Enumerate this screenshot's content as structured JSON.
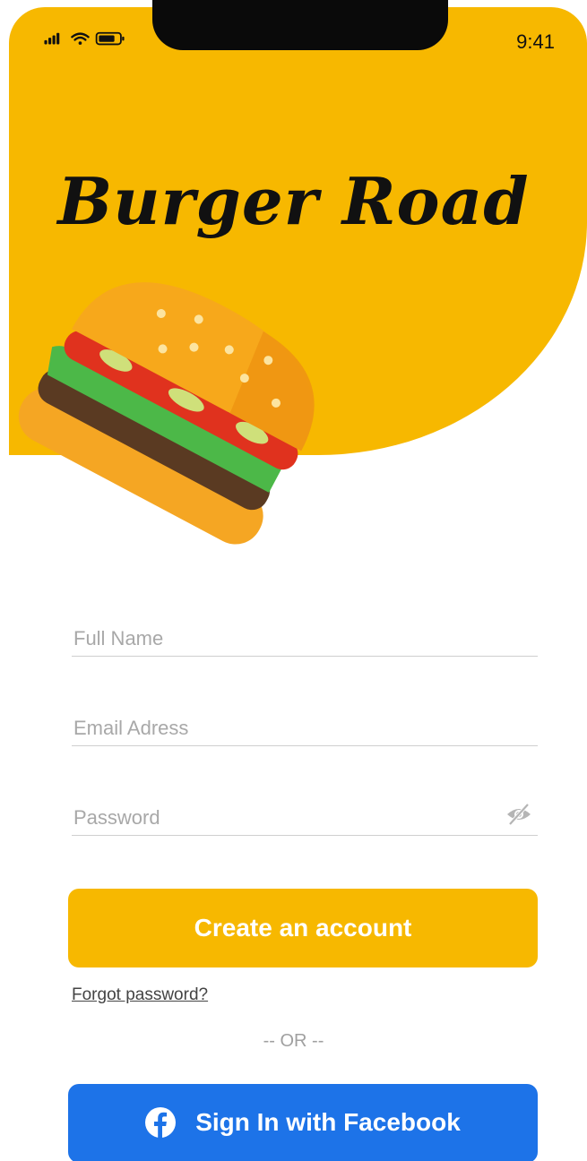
{
  "status_bar": {
    "time": "9:41",
    "icons": [
      "signal-icon",
      "wifi-icon",
      "battery-icon"
    ]
  },
  "app": {
    "title": "Burger Road",
    "illustration": "burger-illustration"
  },
  "form": {
    "full_name": {
      "placeholder": "Full Name",
      "value": ""
    },
    "email": {
      "placeholder": "Email Adress",
      "value": ""
    },
    "password": {
      "placeholder": "Password",
      "value": "",
      "toggle_icon": "eye-slash-icon"
    }
  },
  "actions": {
    "create_account": "Create an account",
    "forgot_password": "Forgot password?",
    "separator": "-- OR --",
    "facebook_sign_in": "Sign In with Facebook"
  },
  "colors": {
    "brand_yellow": "#F7B800",
    "facebook_blue": "#1D73E8",
    "text_dark": "#111111"
  }
}
